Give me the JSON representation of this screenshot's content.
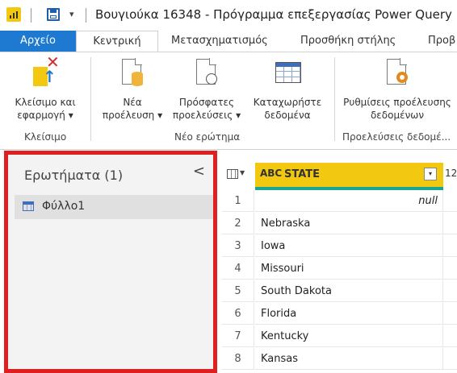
{
  "window": {
    "title": "Βουγιούκα 16348 - Πρόγραμμα επεξεργασίας Power Query",
    "qa_dropdown": "▾"
  },
  "tabs": [
    {
      "label": "Αρχείο"
    },
    {
      "label": "Κεντρική"
    },
    {
      "label": "Μετασχηματισμός"
    },
    {
      "label": "Προσθήκη στήλης"
    },
    {
      "label": "Προβ"
    }
  ],
  "ribbon": {
    "close_apply": {
      "line1": "Κλείσιμο και",
      "line2": "εφαρμογή ▾"
    },
    "new_source": {
      "line1": "Νέα",
      "line2": "προέλευση ▾"
    },
    "recent_sources": {
      "line1": "Πρόσφατες",
      "line2": "προελεύσεις ▾"
    },
    "enter_data": {
      "line1": "Καταχωρήστε",
      "line2": "δεδομένα"
    },
    "source_settings": {
      "line1": "Ρυθμίσεις προέλευσης",
      "line2": "δεδομένων"
    },
    "groups": {
      "close": "Κλείσιμο",
      "new_query": "Νέο ερώτημα",
      "data_sources": "Προελεύσεις δεδομέ..."
    }
  },
  "query_pane": {
    "title": "Ερωτήματα (1)",
    "collapse": "<",
    "items": [
      {
        "label": "Φύλλο1"
      }
    ]
  },
  "grid": {
    "column_type": "ABC",
    "column_name": "STATE",
    "filter_glyph": "▾",
    "next_column_type": "12",
    "rows": [
      {
        "n": "1",
        "value": "null",
        "is_null": true
      },
      {
        "n": "2",
        "value": "Nebraska"
      },
      {
        "n": "3",
        "value": "Iowa"
      },
      {
        "n": "4",
        "value": "Missouri"
      },
      {
        "n": "5",
        "value": "South Dakota"
      },
      {
        "n": "6",
        "value": "Florida"
      },
      {
        "n": "7",
        "value": "Kentucky"
      },
      {
        "n": "8",
        "value": "Kansas"
      }
    ]
  },
  "colors": {
    "accent": "#1e7ad1",
    "header_yellow": "#f2c811",
    "highlight_border": "#e02020",
    "quality_bar": "#19a596"
  }
}
